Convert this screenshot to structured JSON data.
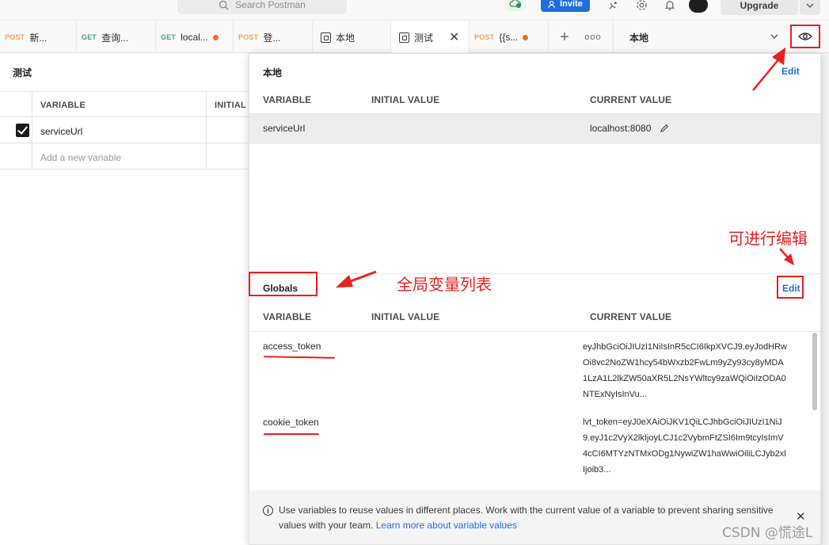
{
  "header": {
    "search_placeholder": "Search Postman",
    "invite_label": "Invite",
    "upgrade_label": "Upgrade"
  },
  "tabs": [
    {
      "method": "POST",
      "label": "新..."
    },
    {
      "method": "GET",
      "label": "查询..."
    },
    {
      "method": "GET",
      "label": "local..."
    },
    {
      "method": "POST",
      "label": "登..."
    },
    {
      "method": "",
      "label": "本地"
    },
    {
      "method": "",
      "label": "测试"
    },
    {
      "method": "POST",
      "label": "{{s..."
    }
  ],
  "environment": {
    "selected": "本地"
  },
  "editor": {
    "title": "测试",
    "columns": [
      "VARIABLE",
      "INITIAL"
    ],
    "rows": [
      {
        "variable": "serviceUrl",
        "checked": true
      }
    ],
    "add_placeholder": "Add a new variable"
  },
  "popover": {
    "local": {
      "title": "本地",
      "edit_label": "Edit",
      "columns": [
        "VARIABLE",
        "INITIAL VALUE",
        "CURRENT VALUE"
      ],
      "rows": [
        {
          "variable": "serviceUrl",
          "initial": "",
          "current": "localhost:8080"
        }
      ]
    },
    "globals": {
      "title": "Globals",
      "edit_label": "Edit",
      "columns": [
        "VARIABLE",
        "INITIAL VALUE",
        "CURRENT VALUE"
      ],
      "rows": [
        {
          "variable": "access_token",
          "initial": "",
          "current": "eyJhbGciOiJIUzI1NiIsInR5cCI6IkpXVCJ9.eyJodHRwOi8vc2NoZW1hcy54bWxzb2FwLm9yZy93cy8yMDA1LzA1L2lkZW50aXR5L2NsYWltcy9zaWQiOiIzODA0NTExNyIsInVu..."
        },
        {
          "variable": "cookie_token",
          "initial": "",
          "current": "lvt_token=eyJ0eXAiOiJKV1QiLCJhbGciOiJIUzI1NiJ9.eyJ1c2VyX2lkIjoyLCJ1c2VybmFtZSI6Im9tcyIsImV4cCI6MTYzNTMxODg1NywiZW1haWwiOiliLCJyb2xlIjoib3..."
        }
      ]
    },
    "info": {
      "text": "Use variables to reuse values in different places. Work with the current value of a variable to prevent sharing sensitive values with your team.",
      "link": "Learn more about variable values"
    }
  },
  "annotations": {
    "editable_note": "可进行编辑",
    "globals_note": "全局变量列表",
    "watermark": "CSDN @慌途L",
    "accent_color": "#e8201f"
  }
}
